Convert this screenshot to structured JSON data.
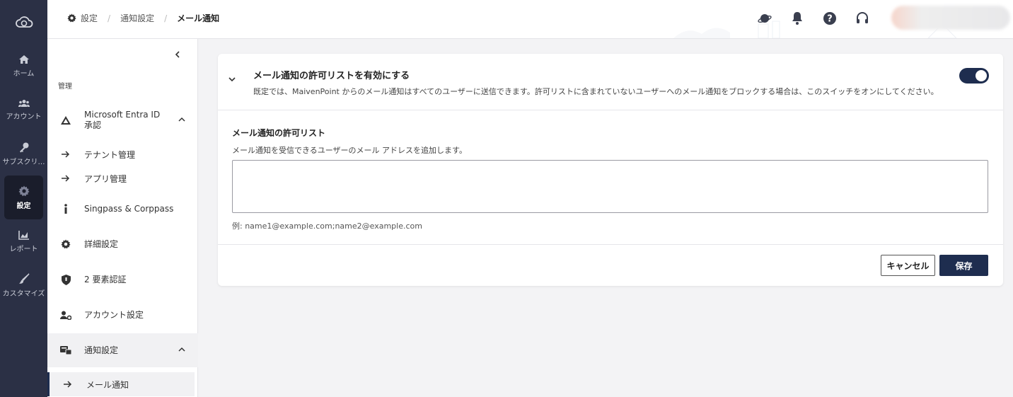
{
  "rail": {
    "items": [
      {
        "label": "ホーム",
        "icon": "home-icon"
      },
      {
        "label": "アカウント",
        "icon": "users-icon"
      },
      {
        "label": "サブスクリ…",
        "icon": "key-icon"
      },
      {
        "label": "設定",
        "icon": "gear-icon",
        "active": true
      },
      {
        "label": "レポート",
        "icon": "chart-icon"
      },
      {
        "label": "カスタマイズ",
        "icon": "brush-icon"
      }
    ]
  },
  "breadcrumb": [
    "設定",
    "通知設定",
    "メール通知"
  ],
  "sidebar": {
    "section_title": "管理",
    "items": [
      {
        "label_line1": "Microsoft Entra ID",
        "label_line2": "承認"
      },
      {
        "label": "テナント管理"
      },
      {
        "label": "アプリ管理"
      },
      {
        "label": "Singpass & Corppass"
      },
      {
        "label": "詳細設定"
      },
      {
        "label": "2 要素認証"
      },
      {
        "label": "アカウント設定"
      },
      {
        "label": "通知設定"
      },
      {
        "label": "メール通知"
      }
    ]
  },
  "card": {
    "title": "メール通知の許可リストを有効にする",
    "description": "既定では、MaivenPoint からのメール通知はすべてのユーザーに送信できます。許可リストに含まれていないユーザーへのメール通知をブロックする場合は、このスイッチをオンにしてください。",
    "toggle_on": true,
    "field_label": "メール通知の許可リスト",
    "field_help": "メール通知を受信できるユーザーのメール アドレスを追加します。",
    "field_value": "",
    "example": "例: name1@example.com;name2@example.com",
    "cancel_label": "キャンセル",
    "save_label": "保存"
  },
  "colors": {
    "rail_bg": "#2b3045",
    "accent": "#1e2d4f"
  }
}
